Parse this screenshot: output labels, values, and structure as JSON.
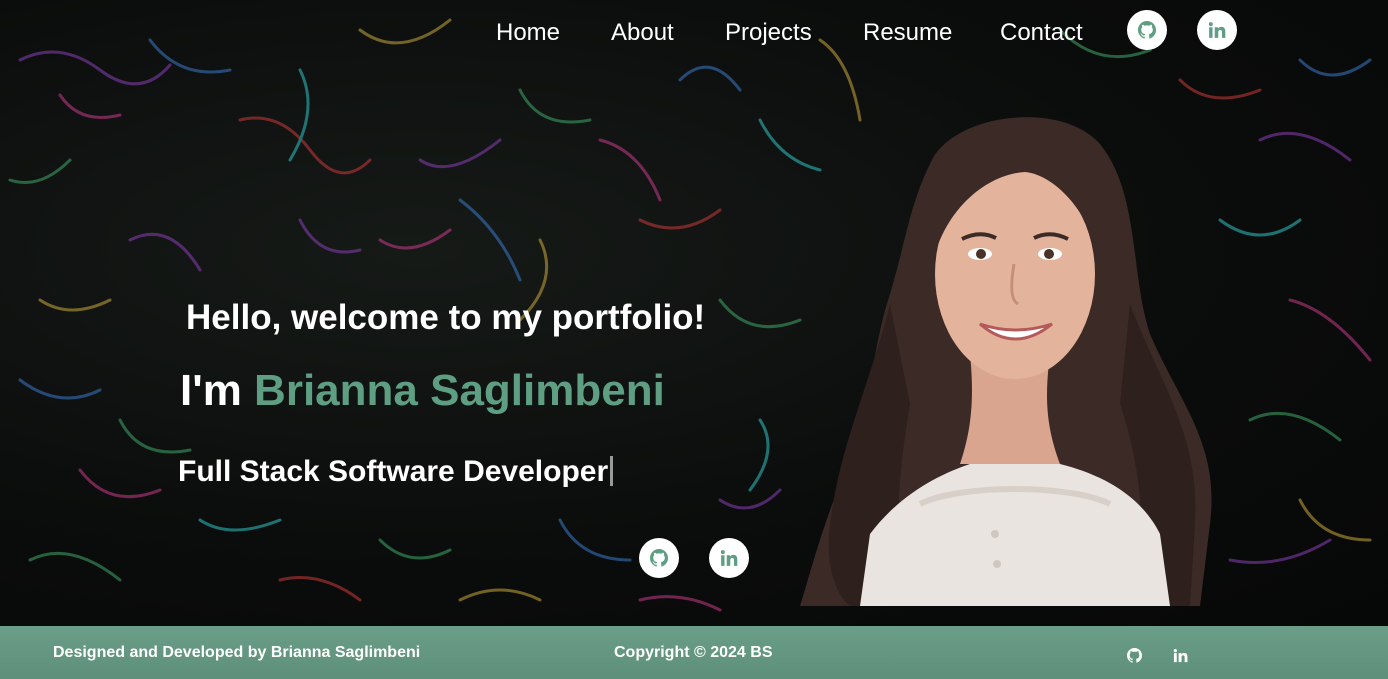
{
  "nav": {
    "links": [
      "Home",
      "About",
      "Projects",
      "Resume",
      "Contact"
    ],
    "github_icon": "github-icon",
    "linkedin_icon": "linkedin-icon"
  },
  "hero": {
    "greeting": "Hello, welcome to my portfolio!",
    "intro_prefix": "I'm ",
    "name": "Brianna Saglimbeni",
    "role": "Full Stack Software Developer",
    "social_icons": [
      "github-icon",
      "linkedin-icon"
    ]
  },
  "footer": {
    "credit": "Designed and Developed by Brianna Saglimbeni",
    "copyright": "Copyright © 2024 BS",
    "social_icons": [
      "github-icon",
      "linkedin-icon"
    ]
  },
  "colors": {
    "accent": "#5e9e82",
    "footer_bg": "#6b9e88",
    "background": "#0b0c0b",
    "text": "#ffffff"
  }
}
